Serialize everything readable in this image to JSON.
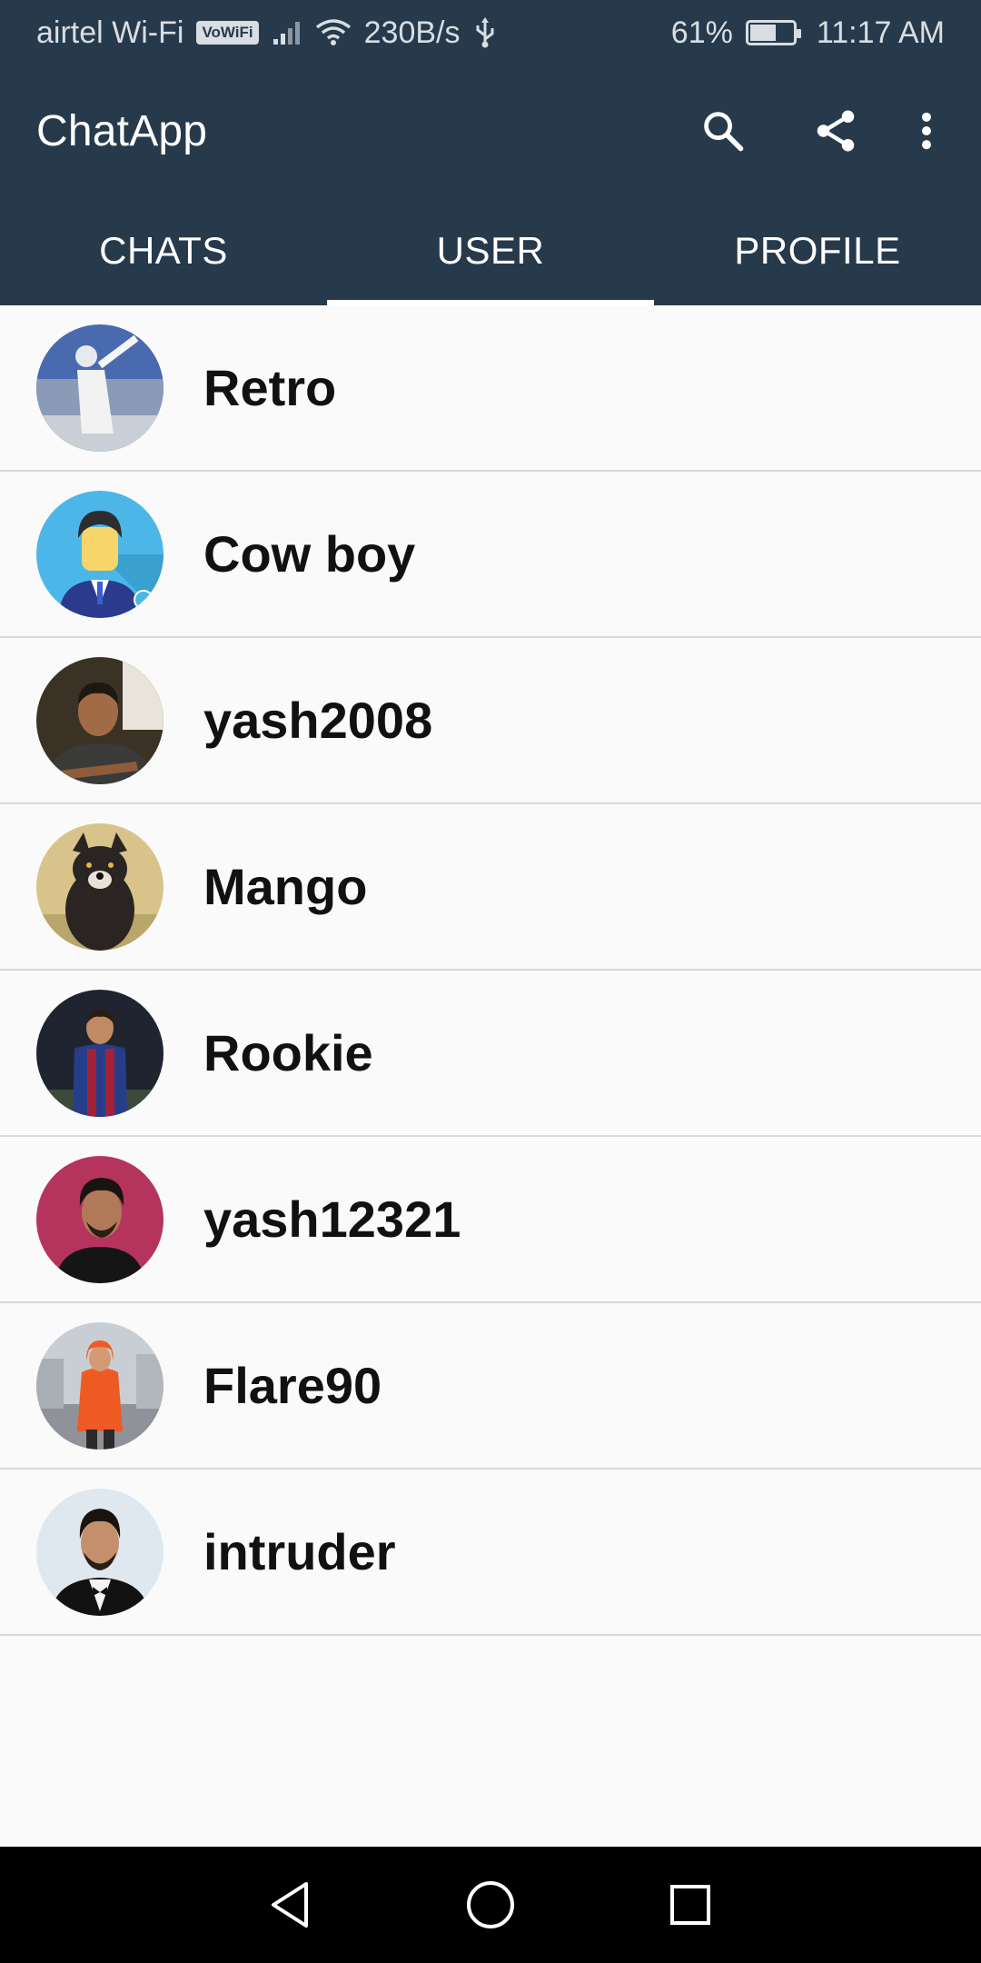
{
  "status_bar": {
    "carrier": "airtel Wi-Fi",
    "vowifi": "VoWiFi",
    "speed": "230B/s",
    "battery_percent": "61%",
    "battery_level": 0.61,
    "time": "11:17 AM"
  },
  "app_bar": {
    "title": "ChatApp",
    "icons": [
      "search-icon",
      "share-icon",
      "more-vert-icon"
    ]
  },
  "tabs": [
    {
      "label": "CHATS",
      "active": false
    },
    {
      "label": "USER",
      "active": true
    },
    {
      "label": "PROFILE",
      "active": false
    }
  ],
  "users": [
    {
      "name": "Retro"
    },
    {
      "name": "Cow boy"
    },
    {
      "name": "yash2008"
    },
    {
      "name": "Mango"
    },
    {
      "name": "Rookie"
    },
    {
      "name": "yash12321"
    },
    {
      "name": "Flare90"
    },
    {
      "name": "intruder"
    }
  ],
  "nav_bar": {
    "icons": [
      "back-icon",
      "home-icon",
      "recents-icon"
    ]
  },
  "colors": {
    "primary": "#263a4c",
    "background": "#fafafa",
    "divider": "#d8d8d8",
    "text": "#111111"
  }
}
